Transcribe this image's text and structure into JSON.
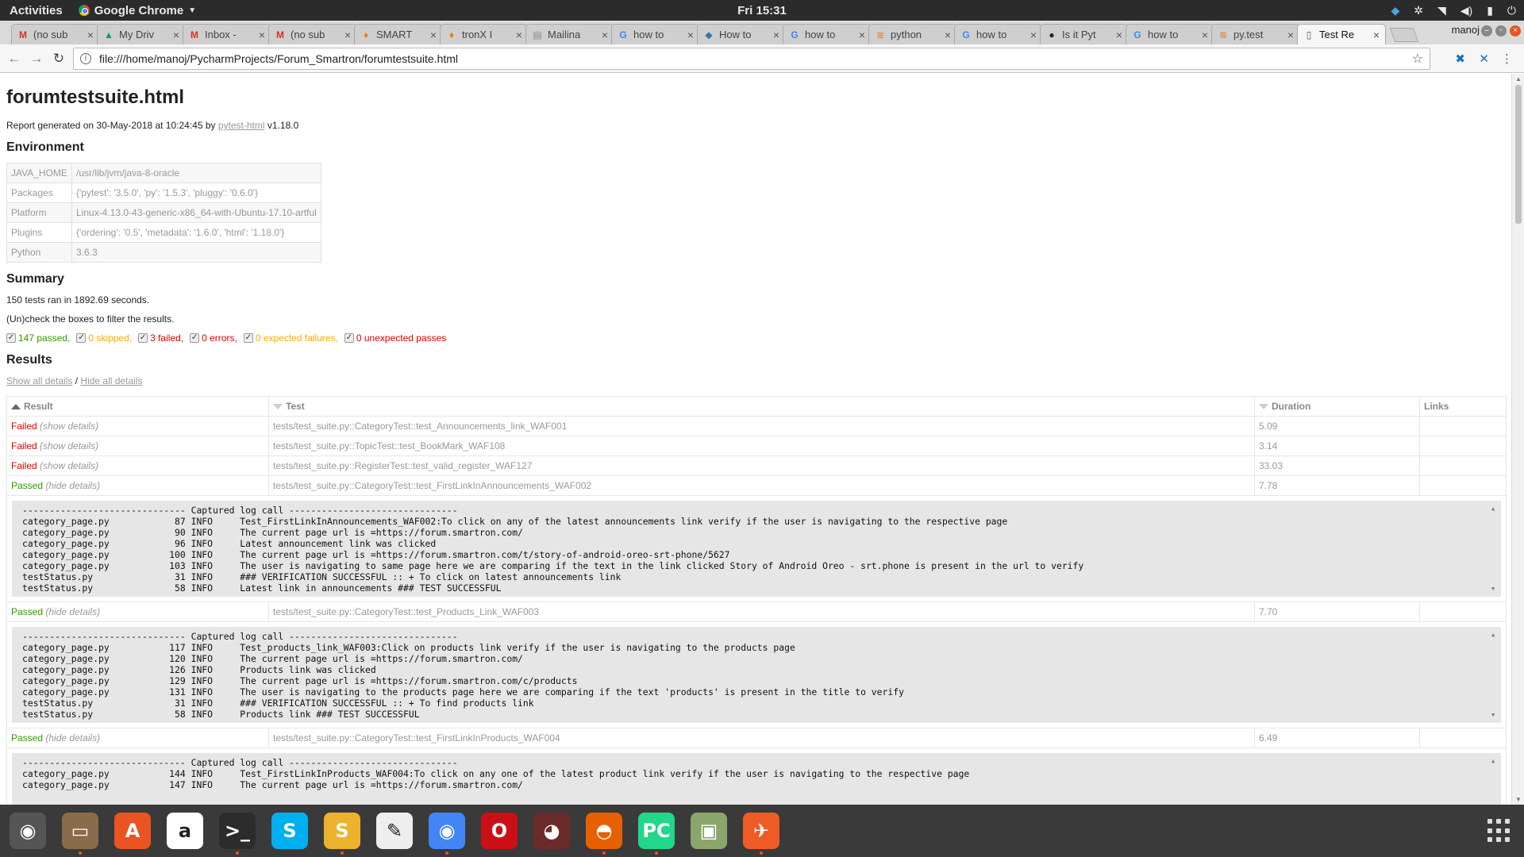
{
  "topbar": {
    "activities": "Activities",
    "app_name": "Google Chrome",
    "clock": "Fri 15:31",
    "tray_icons": [
      "dropbox-icon",
      "settings-icon",
      "wifi-icon",
      "volume-icon",
      "battery-icon",
      "power-icon"
    ]
  },
  "tabs": [
    {
      "icon": "M",
      "icon_color": "#d93025",
      "title": "(no sub"
    },
    {
      "icon": "▲",
      "icon_color": "#0f9d58",
      "title": "My Driv"
    },
    {
      "icon": "M",
      "icon_color": "#d93025",
      "title": "Inbox -"
    },
    {
      "icon": "M",
      "icon_color": "#d93025",
      "title": "(no sub"
    },
    {
      "icon": "♦",
      "icon_color": "#f57c00",
      "title": "SMART"
    },
    {
      "icon": "♦",
      "icon_color": "#f57c00",
      "title": "tronX I"
    },
    {
      "icon": "▤",
      "icon_color": "#888888",
      "title": "Mailina"
    },
    {
      "icon": "G",
      "icon_color": "#4285f4",
      "title": "how to"
    },
    {
      "icon": "◆",
      "icon_color": "#3776ab",
      "title": "How to"
    },
    {
      "icon": "G",
      "icon_color": "#4285f4",
      "title": "how to"
    },
    {
      "icon": "≋",
      "icon_color": "#f48024",
      "title": "python"
    },
    {
      "icon": "G",
      "icon_color": "#4285f4",
      "title": "how to"
    },
    {
      "icon": "●",
      "icon_color": "#222222",
      "title": "Is it Pyt"
    },
    {
      "icon": "G",
      "icon_color": "#4285f4",
      "title": "how to"
    },
    {
      "icon": "≋",
      "icon_color": "#f48024",
      "title": "py.test"
    },
    {
      "icon": "▯",
      "icon_color": "#555555",
      "title": "Test Re",
      "active": true
    }
  ],
  "profile": "manoj",
  "url": "file:///home/manoj/PycharmProjects/Forum_Smartron/forumtestsuite.html",
  "report": {
    "title": "forumtestsuite.html",
    "generated_prefix": "Report generated on 30-May-2018 at 10:24:45 by ",
    "generator_link": "pytest-html",
    "generator_version": " v1.18.0",
    "environment_heading": "Environment",
    "environment": [
      {
        "key": "JAVA_HOME",
        "value": "/usr/lib/jvm/java-8-oracle"
      },
      {
        "key": "Packages",
        "value": "{'pytest': '3.5.0', 'py': '1.5.3', 'pluggy': '0.6.0'}"
      },
      {
        "key": "Platform",
        "value": "Linux-4.13.0-43-generic-x86_64-with-Ubuntu-17.10-artful"
      },
      {
        "key": "Plugins",
        "value": "{'ordering': '0.5', 'metadata': '1.6.0', 'html': '1.18.0'}"
      },
      {
        "key": "Python",
        "value": "3.6.3"
      }
    ],
    "summary_heading": "Summary",
    "summary_line": "150 tests ran in 1892.69 seconds.",
    "filter_hint": "(Un)check the boxes to filter the results.",
    "filters": {
      "passed": "147 passed,",
      "skipped": "0 skipped,",
      "failed": "3 failed,",
      "errors": "0 errors,",
      "xfailed": "0 expected failures,",
      "xpassed": "0 unexpected passes"
    },
    "results_heading": "Results",
    "show_all": "Show all details",
    "separator": " / ",
    "hide_all": "Hide all details",
    "columns": {
      "result": "Result",
      "test": "Test",
      "duration": "Duration",
      "links": "Links"
    },
    "rows": [
      {
        "result": "Failed",
        "toggle": "(show details)",
        "test": "tests/test_suite.py::CategoryTest::test_Announcements_link_WAF001",
        "duration": "5.09",
        "log": null
      },
      {
        "result": "Failed",
        "toggle": "(show details)",
        "test": "tests/test_suite.py::TopicTest::test_BookMark_WAF108",
        "duration": "3.14",
        "log": null
      },
      {
        "result": "Failed",
        "toggle": "(show details)",
        "test": "tests/test_suite.py::RegisterTest::test_valid_register_WAF127",
        "duration": "33.03",
        "log": null
      },
      {
        "result": "Passed",
        "toggle": "(hide details)",
        "test": "tests/test_suite.py::CategoryTest::test_FirstLinkInAnnouncements_WAF002",
        "duration": "7.78",
        "log": "------------------------------ Captured log call -------------------------------\ncategory_page.py            87 INFO     Test_FirstLinkInAnnouncements_WAF002:To click on any of the latest announcements link verify if the user is navigating to the respective page\ncategory_page.py            90 INFO     The current page url is =https://forum.smartron.com/\ncategory_page.py            96 INFO     Latest announcement link was clicked\ncategory_page.py           100 INFO     The current page url is =https://forum.smartron.com/t/story-of-android-oreo-srt-phone/5627\ncategory_page.py           103 INFO     The user is navigating to same page here we are comparing if the text in the link clicked Story of Android Oreo - srt.phone is present in the url to verify\ntestStatus.py               31 INFO     ### VERIFICATION SUCCESSFUL :: + To click on latest announcements link\ntestStatus.py               58 INFO     Latest link in announcements ### TEST SUCCESSFUL"
      },
      {
        "result": "Passed",
        "toggle": "(hide details)",
        "test": "tests/test_suite.py::CategoryTest::test_Products_Link_WAF003",
        "duration": "7.70",
        "log": "------------------------------ Captured log call -------------------------------\ncategory_page.py           117 INFO     Test_products_link_WAF003:Click on products link verify if the user is navigating to the products page\ncategory_page.py           120 INFO     The current page url is =https://forum.smartron.com/\ncategory_page.py           126 INFO     Products link was clicked\ncategory_page.py           129 INFO     The current page url is =https://forum.smartron.com/c/products\ncategory_page.py           131 INFO     The user is navigating to the products page here we are comparing if the text 'products' is present in the title to verify\ntestStatus.py               31 INFO     ### VERIFICATION SUCCESSFUL :: + To find products link\ntestStatus.py               58 INFO     Products link ### TEST SUCCESSFUL"
      },
      {
        "result": "Passed",
        "toggle": "(hide details)",
        "test": "tests/test_suite.py::CategoryTest::test_FirstLinkInProducts_WAF004",
        "duration": "6.49",
        "log": "------------------------------ Captured log call -------------------------------\ncategory_page.py           144 INFO     Test_FirstLinkInProducts_WAF004:To click on any one of the latest product link verify if the user is navigating to the respective page\ncategory_page.py           147 INFO     The current page url is =https://forum.smartron.com/"
      }
    ]
  },
  "dock": [
    {
      "name": "rhythmbox-icon",
      "glyph": "◉",
      "bg": "#555555",
      "running": false
    },
    {
      "name": "files-icon",
      "glyph": "▭",
      "bg": "#8a6b4a",
      "running": true
    },
    {
      "name": "software-center-icon",
      "glyph": "A",
      "bg": "#e95420",
      "running": false
    },
    {
      "name": "amazon-icon",
      "glyph": "a",
      "bg": "#ffffff",
      "running": false
    },
    {
      "name": "terminal-icon",
      "glyph": ">_",
      "bg": "#2c2c2c",
      "running": true
    },
    {
      "name": "skype-icon",
      "glyph": "S",
      "bg": "#00aff0",
      "running": false
    },
    {
      "name": "slack-icon",
      "glyph": "S",
      "bg": "#ecb22e",
      "running": true
    },
    {
      "name": "text-editor-icon",
      "glyph": "✎",
      "bg": "#eeeeee",
      "running": false
    },
    {
      "name": "chrome-icon",
      "glyph": "◉",
      "bg": "#4285f4",
      "running": true
    },
    {
      "name": "opera-icon",
      "glyph": "O",
      "bg": "#cc0f16",
      "running": false
    },
    {
      "name": "hamster-icon",
      "glyph": "◕",
      "bg": "#6b2b2b",
      "running": false
    },
    {
      "name": "firefox-icon",
      "glyph": "◓",
      "bg": "#e66000",
      "running": true
    },
    {
      "name": "pycharm-icon",
      "glyph": "PC",
      "bg": "#21d789",
      "running": true
    },
    {
      "name": "image-viewer-icon",
      "glyph": "▣",
      "bg": "#8aa66a",
      "running": false
    },
    {
      "name": "postman-icon",
      "glyph": "✈",
      "bg": "#ef5b25",
      "running": true
    }
  ]
}
